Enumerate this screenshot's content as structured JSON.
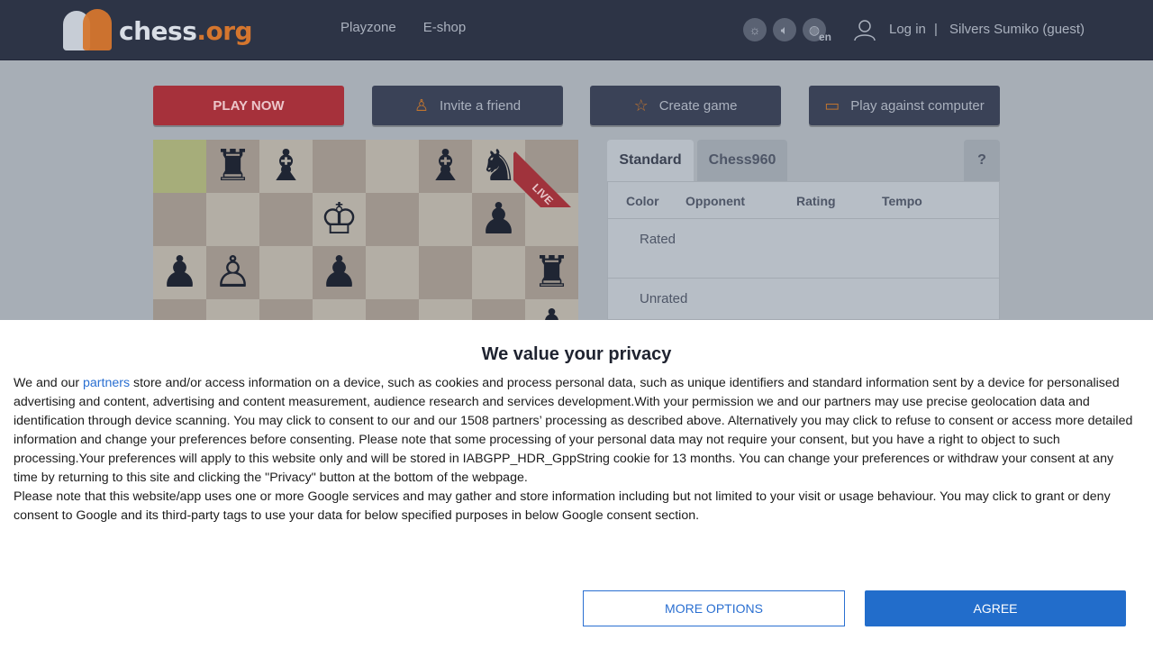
{
  "header": {
    "logo": {
      "part1": "chess",
      "part2": ".org"
    },
    "nav": [
      "Playzone",
      "E-shop"
    ],
    "icons": [
      "brightness-icon",
      "sound-icon",
      "globe-icon"
    ],
    "lang": "en",
    "login": "Log in",
    "separator": "|",
    "user": "Silvers Sumiko (guest)"
  },
  "actions": {
    "play_now": "PLAY NOW",
    "invite": "Invite a friend",
    "create": "Create game",
    "computer": "Play against computer"
  },
  "board": {
    "live_label": "LIVE",
    "pieces": [
      {
        "file": 1,
        "rank": 0,
        "glyph": "♜"
      },
      {
        "file": 2,
        "rank": 0,
        "glyph": "♝"
      },
      {
        "file": 5,
        "rank": 0,
        "glyph": "♝"
      },
      {
        "file": 6,
        "rank": 0,
        "glyph": "♞"
      },
      {
        "file": 3,
        "rank": 1,
        "glyph": "♔"
      },
      {
        "file": 6,
        "rank": 1,
        "glyph": "♟"
      },
      {
        "file": 0,
        "rank": 2,
        "glyph": "♟"
      },
      {
        "file": 1,
        "rank": 2,
        "glyph": "♙"
      },
      {
        "file": 3,
        "rank": 2,
        "glyph": "♟"
      },
      {
        "file": 7,
        "rank": 2,
        "glyph": "♜"
      },
      {
        "file": 7,
        "rank": 3,
        "glyph": "♟"
      }
    ]
  },
  "panel": {
    "tabs": [
      "Standard",
      "Chess960",
      "?"
    ],
    "columns": [
      "Color",
      "Opponent",
      "Rating",
      "Tempo"
    ],
    "groups": [
      "Rated",
      "Unrated"
    ]
  },
  "consent": {
    "title": "We value your privacy",
    "p1_before_link": "We and our ",
    "link": "partners",
    "p1_after_link": " store and/or access information on a device, such as cookies and process personal data, such as unique identifiers and standard information sent by a device for personalised advertising and content, advertising and content measurement, audience research and services development.With your permission we and our partners may use precise geolocation data and identification through device scanning. You may click to consent to our and our 1508 partners’ processing as described above. Alternatively you may click to refuse to consent or access more detailed information and change your preferences before consenting. Please note that some processing of your personal data may not require your consent, but you have a right to object to such processing.Your preferences will apply to this website only and will be stored in IABGPP_HDR_GppString cookie for 13 months. You can change your preferences or withdraw your consent at any time by returning to this site and clicking the \"Privacy\" button at the bottom of the webpage.",
    "p2": "Please note that this website/app uses one or more Google services and may gather and store information including but not limited to your visit or usage behaviour. You may click to grant or deny consent to Google and its third-party tags to use your data for below specified purposes in below Google consent section.",
    "more_options": "MORE OPTIONS",
    "agree": "AGREE"
  }
}
